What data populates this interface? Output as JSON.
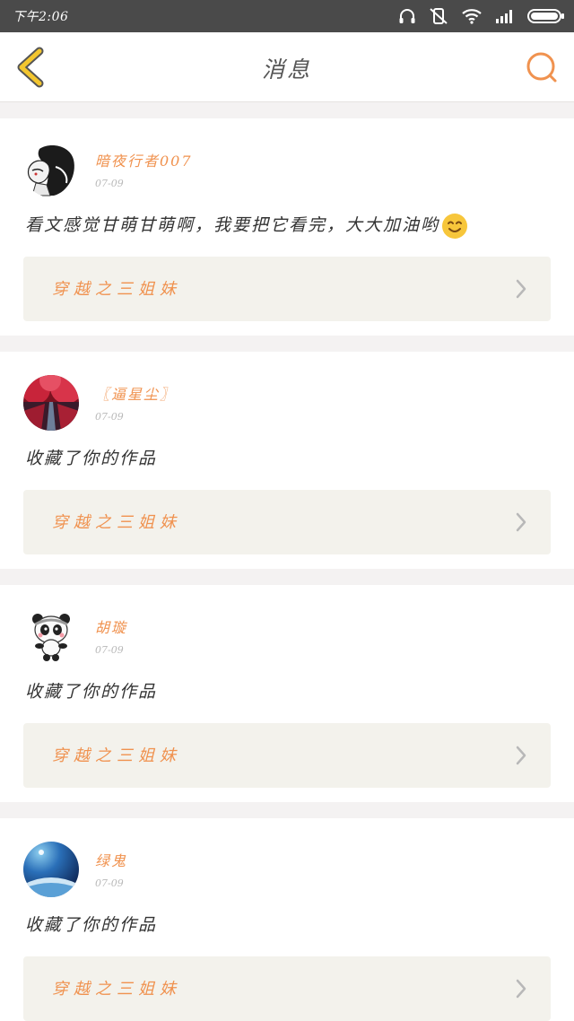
{
  "status_bar": {
    "time": "下午2:06",
    "icons": [
      "headphones-icon",
      "vibrate-off-icon",
      "wifi-icon",
      "signal-icon",
      "battery-icon"
    ]
  },
  "header": {
    "title": "消息",
    "back_icon": "chevron-left-icon",
    "search_icon": "search-icon"
  },
  "colors": {
    "accent": "#f0924f",
    "back_icon": "#f3c62f",
    "status_bar": "#4a4a4a",
    "work_bg": "#f3f2ec"
  },
  "messages": [
    {
      "username": "暗夜行者007",
      "date": "07-09",
      "text": "看文感觉甘萌甘萌啊，我要把它看完，大大加油哟",
      "emoji": "smile-emoji",
      "work_title": "穿越之三姐妹",
      "avatar": "ink-portrait-avatar"
    },
    {
      "username": "〖逼星尘〗",
      "date": "07-09",
      "text": "收藏了你的作品",
      "work_title": "穿越之三姐妹",
      "avatar": "red-tree-road-avatar"
    },
    {
      "username": "胡璇",
      "date": "07-09",
      "text": "收藏了你的作品",
      "work_title": "穿越之三姐妹",
      "avatar": "panda-avatar"
    },
    {
      "username": "绿鬼",
      "date": "07-09",
      "text": "收藏了你的作品",
      "work_title": "穿越之三姐妹",
      "avatar": "earth-space-avatar"
    }
  ]
}
